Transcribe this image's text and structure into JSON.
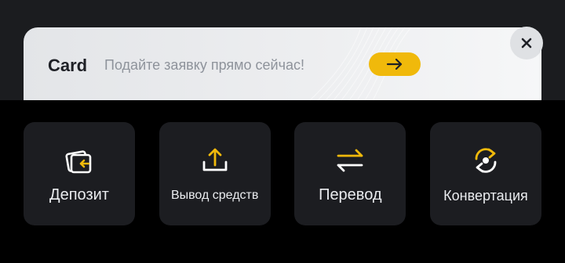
{
  "colors": {
    "accent": "#f0b90b",
    "tile_bg": "#1c1d21",
    "page_bg": "#000000",
    "banner_bg": "#e8e9eb"
  },
  "promo": {
    "title": "Card",
    "text": "Подайте заявку прямо сейчас!",
    "go_icon": "arrow-right-icon",
    "close_icon": "close-icon"
  },
  "actions": [
    {
      "label": "Депозит",
      "icon": "deposit-icon"
    },
    {
      "label": "Вывод средств",
      "icon": "withdraw-icon"
    },
    {
      "label": "Перевод",
      "icon": "transfer-icon"
    },
    {
      "label": "Конвертация",
      "icon": "convert-icon"
    }
  ]
}
